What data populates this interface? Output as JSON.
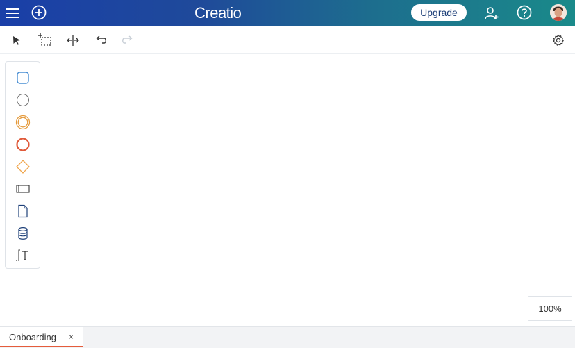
{
  "header": {
    "brand": "Creatio",
    "upgrade_label": "Upgrade",
    "icons": [
      "menu-icon",
      "add-circle-icon",
      "add-user-icon",
      "help-icon",
      "avatar"
    ]
  },
  "toolbar": {
    "icons": [
      "pointer-icon",
      "marquee-select-icon",
      "space-tool-icon",
      "undo-icon",
      "redo-icon",
      "gear-icon"
    ]
  },
  "palette": {
    "items": [
      "task-icon",
      "start-event-icon",
      "intermediate-event-icon",
      "end-event-icon",
      "gateway-icon",
      "lane-icon",
      "data-object-icon",
      "data-store-icon",
      "text-annotation-icon"
    ]
  },
  "zoom": {
    "level": "100%"
  },
  "tabs": [
    {
      "label": "Onboarding",
      "close": "×"
    }
  ],
  "colors": {
    "header_start": "#1a3fa8",
    "header_end": "#1a8a8a",
    "accent_tab": "#e55c3c",
    "task_blue": "#4a8fd3",
    "event_grey": "#6f6f6f",
    "intermediate_orange": "#e59a3b",
    "end_red": "#e05a3a",
    "gateway_orange": "#f0a64d"
  }
}
